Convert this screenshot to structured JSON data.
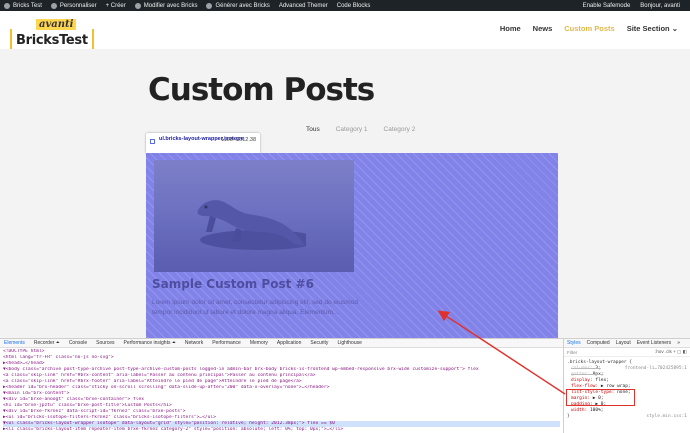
{
  "admin_bar": {
    "items": [
      {
        "icon": "wordpress-icon",
        "label": "Bricks Test"
      },
      {
        "icon": "brush-icon",
        "label": "Personnaliser"
      },
      {
        "icon": "plus-icon",
        "label": "+ Créer"
      },
      {
        "icon": "bricks-icon",
        "label": "Modifier avec Bricks"
      },
      {
        "icon": "bricks-icon",
        "label": "Générer avec Bricks"
      },
      {
        "icon": "",
        "label": "Advanced Themer"
      },
      {
        "icon": "",
        "label": "Code Blocks"
      }
    ],
    "right": [
      "Enable Safemode",
      "Bonjour, avanti"
    ]
  },
  "logo": {
    "top": "avanti",
    "name": "BricksTest"
  },
  "nav": {
    "items": [
      "Home",
      "News",
      "Custom Posts",
      "Site Section ⌄"
    ],
    "active_index": 2
  },
  "page": {
    "title": "Custom Posts",
    "filters": [
      "Tous",
      "Category 1",
      "Category 2"
    ],
    "post_title": "Sample Custom Post #6",
    "excerpt": "Lorem ipsum dolor sit amet, consectetur adipiscing elit, sed do eiusmod tempor incididunt ut labore et dolore magna aliqua. Elementum..."
  },
  "tooltip": {
    "selector": "ul.bricks-layout-wrapper.isotope",
    "dimensions": "1100×2012.38"
  },
  "devtools": {
    "tabs": [
      "Elements",
      "Recorder ⏶",
      "Console",
      "Sources",
      "Performance insights ⏶",
      "Network",
      "Performance",
      "Memory",
      "Application",
      "Security",
      "Lighthouse"
    ],
    "active_tab": 0,
    "dom_lines": [
      "<!DOCTYPE html>",
      "<html lang=\"fr-FR\" class=\"no-js no-svg\">",
      "▶<head>…</head>",
      "▼<body class=\"archive post-type-archive post-type-archive-custom-posts logged-in admin-bar brx-body bricks-is-frontend wp-embed-responsive brx-wide customize-support\"> flex",
      "  <a class=\"skip-link\" href=\"#brx-content\" aria-label=\"Passer au contenu principal\">Passer au contenu principal</a>",
      "  <a class=\"skip-link\" href=\"#brx-footer\" aria-label=\"Atteindre le pied de page\">Atteindre le pied de page</a>",
      "  ▶<header id=\"brx-header\" class=\"sticky on-scroll scrolling\" data-slide-up-after=\"200\" data-x-overlay=\"none\">…</header>",
      "  ▼<main id=\"brx-content\">",
      "    ▼<div id=\"brxe-anoogt\" class=\"brxe-container\"> flex",
      "      <h1 id=\"brxe-jpztu\" class=\"brxe-post-title\">Custom Posts</h1>",
      "      ▼<div id=\"brxe-fkrnez\" data-script-id=\"fkrnez\" class=\"brxe-posts\">",
      "        ▶<ul id=\"bricks-isotope-filters-fkrnez\" class=\"bricks-isotope-filters\">…</ul>",
      "        ▼<ul class=\"bricks-layout-wrapper isotope\" data-layout=\"grid\" style=\"position: relative; height: 2012.38px;\"> flex == $0",
      "          ▶<li class=\"bricks-layout-item repeater-item brxe-fkrnez category-2\" style=\"position: absolute; left: 0%; top: 0px;\">…</li>"
    ],
    "styles_panel": {
      "tabs": [
        "Styles",
        "Computed",
        "Layout",
        "Event Listeners",
        "»"
      ],
      "active_tab": 0,
      "filter_placeholder": "Filter",
      "pseudo": ":hov .cls + ▢ ◧",
      "rule_selector": ".bricks-layout-wrapper {",
      "rule_source": "frontend-li…702425895:1",
      "props": [
        {
          "name": "columns",
          "value": "3;",
          "strike": true
        },
        {
          "name": "gutter",
          "value": "0px;",
          "strike": true
        },
        {
          "name": "display",
          "value": "flex;",
          "strike": false
        },
        {
          "name": "flex-flow",
          "value": "▶ row wrap;",
          "strike": false
        },
        {
          "name": "list-style-type",
          "value": "none;",
          "strike": false
        },
        {
          "name": "margin",
          "value": "▶ 0;",
          "strike": false
        },
        {
          "name": "padding",
          "value": "▶ 0;",
          "strike": false
        },
        {
          "name": "width",
          "value": "100%;",
          "strike": false
        }
      ],
      "footer": "}",
      "footer_source": "style.min.css:1"
    }
  },
  "colors": {
    "overlay": "#6f70e6",
    "accent": "#e0b84b",
    "annotation": "#e0312a"
  }
}
